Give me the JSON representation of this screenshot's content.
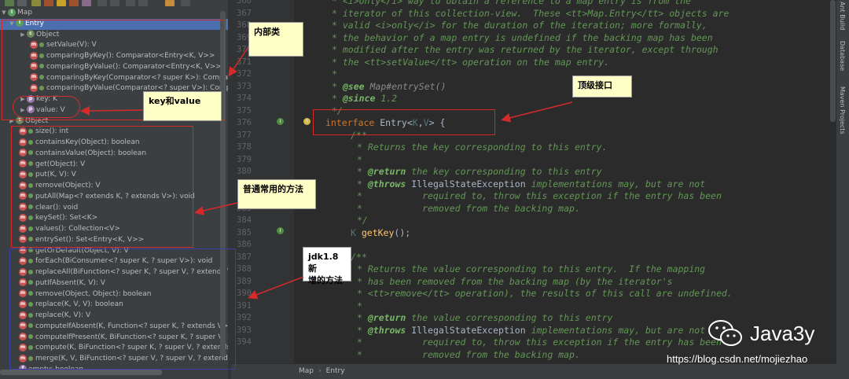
{
  "colors": {
    "structure_bg": "#3c3f41",
    "editor_bg": "#2b2b2b",
    "selection": "#4b6eaf",
    "annotation_red": "#d42a2a",
    "annotation_blue": "#3a3fa8",
    "note_bg": "#ffffc8"
  },
  "structure": {
    "root": {
      "label": "Map",
      "icon": "interface-icon"
    },
    "entry": {
      "label": "Entry",
      "icon": "interface-icon"
    },
    "entry_object": "Object",
    "entry_methods": [
      "setValue(V): V",
      "comparingByKey(): Comparator<Entry<K, V>>",
      "comparingByValue(): Comparator<Entry<K, V>>",
      "comparingByKey(Comparator<? super K>): Compara",
      "comparingByValue(Comparator<? super V>): Compar"
    ],
    "entry_props": [
      "key: K",
      "value: V"
    ],
    "object": "Object",
    "methods": [
      "size(): int",
      "containsKey(Object): boolean",
      "containsValue(Object): boolean",
      "get(Object): V",
      "put(K, V): V",
      "remove(Object): V",
      "putAll(Map<? extends K, ? extends V>): void",
      "clear(): void",
      "keySet(): Set<K>",
      "values(): Collection<V>",
      "entrySet(): Set<Entry<K, V>>"
    ],
    "java8_methods": [
      "getOrDefault(Object, V): V",
      "forEach(BiConsumer<? super K, ? super V>): void",
      "replaceAll(BiFunction<? super K, ? super V, ? extends V>",
      "putIfAbsent(K, V): V",
      "remove(Object, Object): boolean",
      "replace(K, V, V): boolean",
      "replace(K, V): V",
      "computeIfAbsent(K, Function<? super K, ? extends V>): V",
      "computeIfPresent(K, BiFunction<? super K, ? super V, ? e",
      "compute(K, BiFunction<? super K, ? super V, ? extends V",
      "merge(K, V, BiFunction<? super V, ? super V, ? extends V"
    ],
    "last_item": "empty: boolean"
  },
  "editor": {
    "line_numbers": [
      "366",
      "367",
      "368",
      "369",
      "370",
      "371",
      "372",
      "373",
      "374",
      "375",
      "376",
      "377",
      "378",
      "379",
      "380",
      "381",
      "382",
      "383",
      "384",
      "385",
      "386",
      "387",
      "388",
      "389",
      "390",
      "391",
      "392",
      "393",
      "394"
    ],
    "lines": {
      "l366": "* <i>only</i> way to obtain a reference to a map entry is from the",
      "l367": "* iterator of this collection-view.  These <tt>Map.Entry</tt> objects are",
      "l368": "* valid <i>only</i> for the duration of the iteration; more formally,",
      "l369": "* the behavior of a map entry is undefined if the backing map has been",
      "l370": "* modified after the entry was returned by the iterator, except through",
      "l371": "* the <tt>setValue</tt> operation on the map entry.",
      "l372": "*",
      "l373_tag": "@see",
      "l373_rest": " Map#entrySet()",
      "l374_tag": "@since",
      "l374_rest": " 1.2",
      "l375c": "*/",
      "l376_kw": "interface",
      "l376_name": " Entry<",
      "l376_k": "K",
      "l376_c": ",",
      "l376_v": "V",
      "l376_end": "> {",
      "l377": "/**",
      "l378": "* Returns the key corresponding to this entry.",
      "l379": "*",
      "l380_tag": "@return",
      "l380_rest": " the key corresponding to this entry",
      "l381_tag": "@throws",
      "l381_type": " IllegalStateException",
      "l381_rest": " implementations may, but are not",
      "l382": "*           required to, throw this exception if the entry has been",
      "l383": "*           removed from the backing map.",
      "l384": "*/",
      "l385_type": "K",
      "l385_fn": " getKey",
      "l385_end": "();",
      "l387": "/**",
      "l388": "* Returns the value corresponding to this entry.  If the mapping",
      "l389": "* has been removed from the backing map (by the iterator's",
      "l390": "* <tt>remove</tt> operation), the results of this call are undefined.",
      "l391": "*",
      "l392_tag": "@return",
      "l392_rest": " the value corresponding to this entry",
      "l393_tag": "@throws",
      "l393_type": " IllegalStateException",
      "l393_rest": " implementations may, but are not",
      "l394": "*           required to, throw this exception if the entry has been",
      "l395": "*           removed from the backing map."
    }
  },
  "right_strip": [
    "Ant Build",
    "Database",
    "Maven Projects"
  ],
  "breadcrumb": [
    "Map",
    "Entry"
  ],
  "annotations": {
    "inner_class": "内部类",
    "key_value": "key和value",
    "common_methods": "普通常用的方法",
    "top_interface": "顶级接口",
    "jdk18_line1": "jdk1.8新",
    "jdk18_line2": "增的方法"
  },
  "watermark": {
    "brand": "Java3y",
    "url": "https://blog.csdn.net/mojiezhao"
  }
}
